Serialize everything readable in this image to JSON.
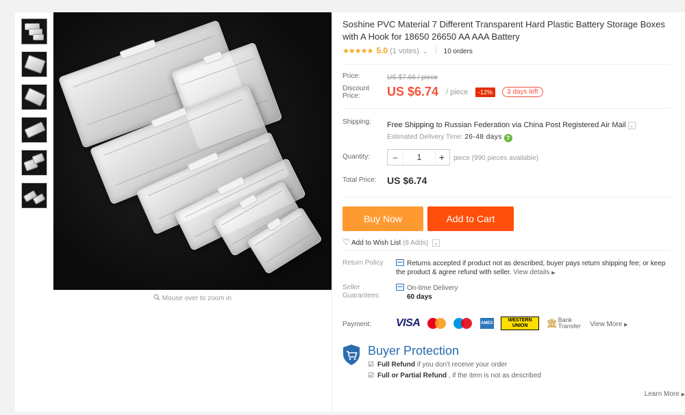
{
  "product": {
    "title": "Soshine PVC Material 7 Different Transparent Hard Plastic Battery Storage Boxes with A Hook for 18650 26650 AA AAA Battery",
    "stars": "★★★★★",
    "rating": "5.0",
    "votes": "(1 votes)",
    "orders": "10 orders"
  },
  "gallery": {
    "zoom_hint": "Mouse over to zoom in",
    "thumb_count": 6
  },
  "price": {
    "label": "Price:",
    "old": "US $7.66 / piece",
    "discount_label": "Discount Price:",
    "now": "US $6.74",
    "unit": "/ piece",
    "percent_off": "-12%",
    "days_left": "3 days left"
  },
  "shipping": {
    "label": "Shipping:",
    "free_text": "Free Shipping",
    "to_text": "to Russian Federation via China Post Registered Air Mail",
    "est_label": "Estimated Delivery Time:",
    "est_value": "26-48 days"
  },
  "quantity": {
    "label": "Quantity:",
    "value": "1",
    "minus": "–",
    "plus": "+",
    "unit_available": "piece (990 pieces available)"
  },
  "total": {
    "label": "Total Price:",
    "value": "US $6.74"
  },
  "buttons": {
    "buy_now": "Buy Now",
    "add_to_cart": "Add to Cart"
  },
  "wishlist": {
    "label": "Add to Wish List",
    "adds": "(8 Adds)"
  },
  "return_policy": {
    "label": "Return Policy",
    "text": "Returns accepted if product not as described, buyer pays return shipping fee; or keep the product & agree refund with seller.",
    "view_details": "View details"
  },
  "guarantee": {
    "label": "Seller Guarantees:",
    "type": "On-time Delivery",
    "days": "60 days"
  },
  "payment": {
    "label": "Payment:",
    "visa": "VISA",
    "mastercard": "mastercard",
    "maestro": "Maestro",
    "amex": "AMEX",
    "western_union": "WESTERN UNION",
    "bank_line1": "Bank",
    "bank_line2": "Transfer",
    "view_more": "View More"
  },
  "buyer_protection": {
    "title": "Buyer Protection",
    "line1_bold": "Full Refund",
    "line1_rest": " if you don't receive your order",
    "line2_bold": "Full or Partial Refund",
    "line2_rest": " , if the item is not as described",
    "learn_more": "Learn More"
  },
  "colors": {
    "price_red": "#f5513b",
    "buy_now_orange": "#ff9a31",
    "add_cart_orange": "#ff4f0a",
    "protection_blue": "#2b6cb0",
    "star_gold": "#f5a623"
  }
}
